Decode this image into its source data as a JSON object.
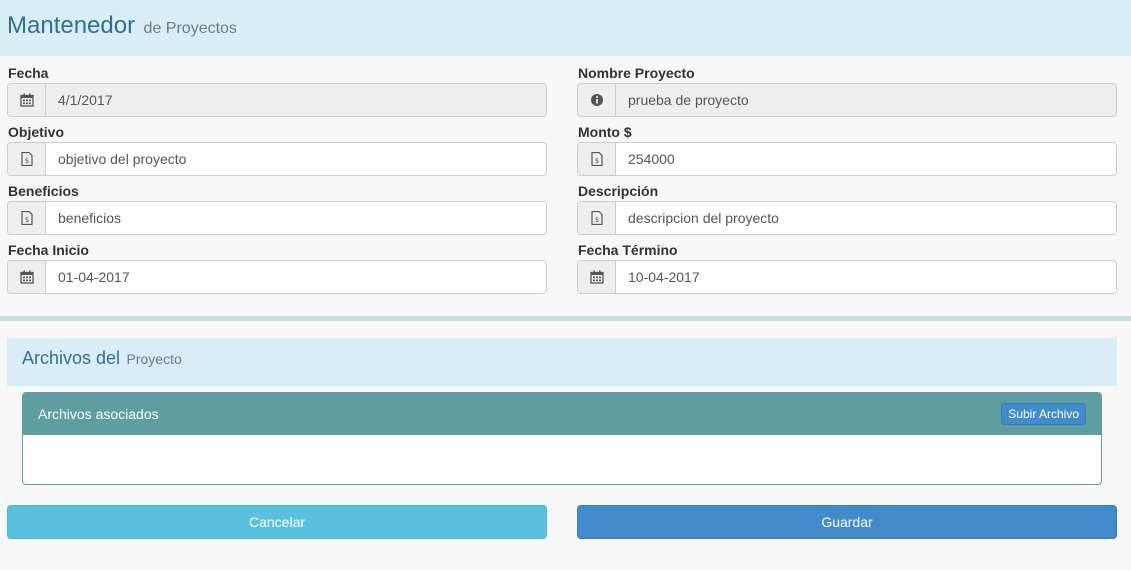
{
  "header": {
    "title": "Mantenedor",
    "subtitle": "de Proyectos"
  },
  "form": {
    "fecha": {
      "label": "Fecha",
      "value": "4/1/2017",
      "icon": "calendar-icon"
    },
    "nombre": {
      "label": "Nombre Proyecto",
      "value": "prueba de proyecto",
      "icon": "info-icon"
    },
    "objetivo": {
      "label": "Objetivo",
      "value": "objetivo del proyecto",
      "icon": "document-icon"
    },
    "monto": {
      "label": "Monto $",
      "value": "254000",
      "icon": "document-icon"
    },
    "beneficios": {
      "label": "Beneficios",
      "value": "beneficios",
      "icon": "document-icon"
    },
    "descripcion": {
      "label": "Descripción",
      "value": "descripcion del proyecto",
      "icon": "document-icon"
    },
    "fecha_inicio": {
      "label": "Fecha Inicio",
      "value": "01-04-2017",
      "icon": "calendar-icon"
    },
    "fecha_termino": {
      "label": "Fecha Término",
      "value": "10-04-2017",
      "icon": "calendar-icon"
    }
  },
  "files": {
    "title": "Archivos del",
    "subtitle": "Proyecto",
    "panel_title": "Archivos asociados",
    "upload_label": "Subir Archivo"
  },
  "actions": {
    "cancel_label": "Cancelar",
    "save_label": "Guardar"
  },
  "colors": {
    "header_bg": "#d9edf7",
    "header_text": "#31708f",
    "panel_heading": "#5f9ea0",
    "btn_primary": "#428bca",
    "btn_info": "#5bc0de"
  }
}
